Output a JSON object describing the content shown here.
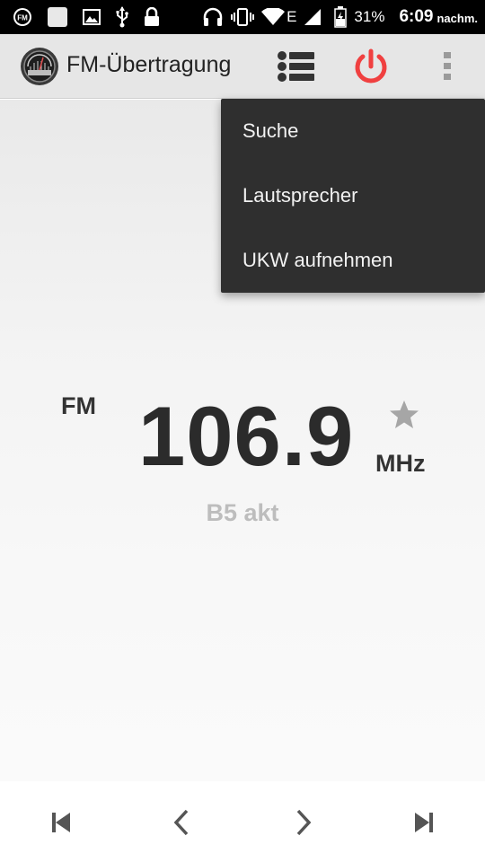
{
  "status_bar": {
    "battery_percent": "31%",
    "time": "6:09",
    "time_suffix": "nachm.",
    "network": "E",
    "left_icons": [
      "fm-notification-icon",
      "square-notification-icon",
      "gallery-icon",
      "usb-icon",
      "lock-icon"
    ],
    "right_icons": [
      "headset-icon",
      "vibrate-icon",
      "wifi-icon",
      "signal-icon",
      "battery-icon"
    ]
  },
  "app_bar": {
    "title": "FM-Übertragung",
    "icons": [
      "radio-logo-icon",
      "station-list-icon",
      "power-icon",
      "overflow-menu-icon"
    ],
    "power_color": "#f04040"
  },
  "tuner": {
    "band": "FM",
    "frequency": "106.9",
    "unit": "MHz",
    "station_name": "B5 akt",
    "favorite": false
  },
  "menu": {
    "items": [
      {
        "label": "Suche"
      },
      {
        "label": "Lautsprecher"
      },
      {
        "label": "UKW aufnehmen"
      }
    ]
  },
  "controls": [
    "seek-prev-icon",
    "step-down-icon",
    "step-up-icon",
    "seek-next-icon"
  ]
}
